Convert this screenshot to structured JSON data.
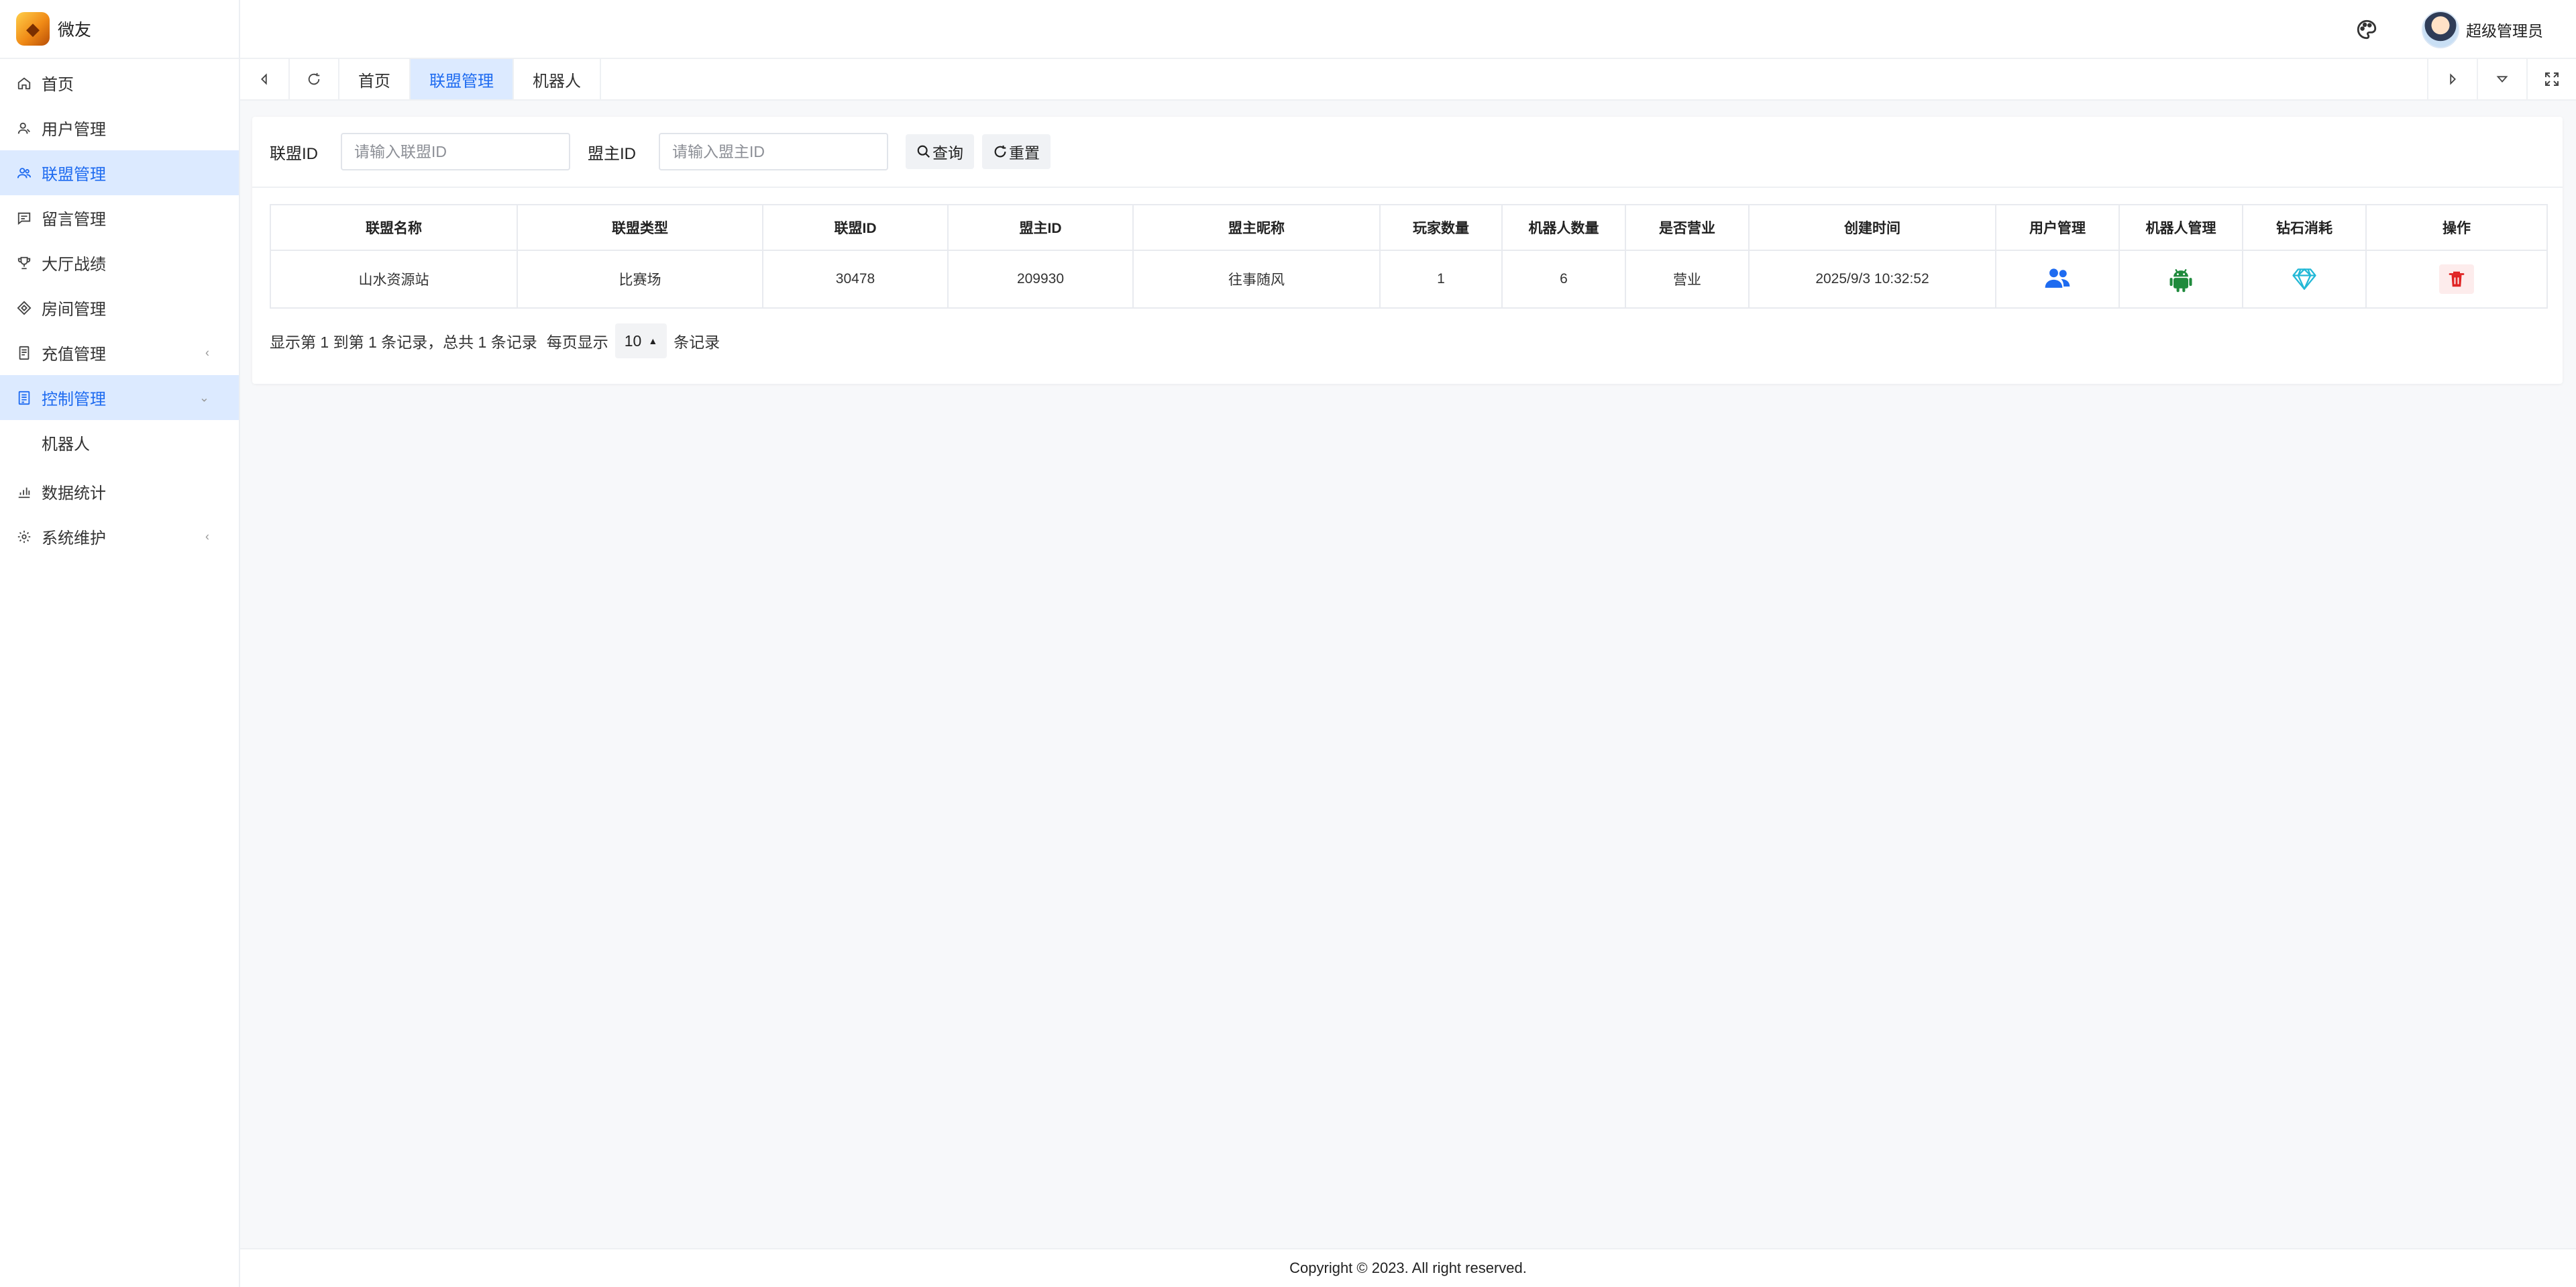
{
  "app": {
    "name": "微友"
  },
  "header": {
    "user_name": "超级管理员"
  },
  "sidebar": {
    "items": [
      {
        "label": "首页",
        "icon": "home-icon"
      },
      {
        "label": "用户管理",
        "icon": "user-icon"
      },
      {
        "label": "联盟管理",
        "icon": "users-icon",
        "active": true
      },
      {
        "label": "留言管理",
        "icon": "message-icon"
      },
      {
        "label": "大厅战绩",
        "icon": "trophy-icon"
      },
      {
        "label": "房间管理",
        "icon": "diamond-icon"
      },
      {
        "label": "充值管理",
        "icon": "receipt-icon"
      },
      {
        "label": "控制管理",
        "icon": "control-icon"
      },
      {
        "label": "机器人",
        "icon": ""
      },
      {
        "label": "数据统计",
        "icon": "chart-icon"
      },
      {
        "label": "系统维护",
        "icon": "gear-icon"
      }
    ]
  },
  "tabs": {
    "items": [
      "首页",
      "联盟管理",
      "机器人"
    ],
    "active": "联盟管理"
  },
  "search": {
    "alliance_id_label": "联盟ID",
    "alliance_id_placeholder": "请输入联盟ID",
    "owner_id_label": "盟主ID",
    "owner_id_placeholder": "请输入盟主ID",
    "query_label": "查询",
    "reset_label": "重置"
  },
  "table": {
    "headers": [
      "联盟名称",
      "联盟类型",
      "联盟ID",
      "盟主ID",
      "盟主昵称",
      "玩家数量",
      "机器人数量",
      "是否营业",
      "创建时间",
      "用户管理",
      "机器人管理",
      "钻石消耗",
      "操作"
    ],
    "rows": [
      {
        "name": "山水资源站",
        "type": "比赛场",
        "alliance_id": "30478",
        "owner_id": "209930",
        "owner_nick": "往事随风",
        "players": "1",
        "robots": "6",
        "open": "营业",
        "created": "2025/9/3 10:32:52"
      }
    ]
  },
  "pagination": {
    "summary": "显示第 1 到第 1 条记录，总共 1 条记录",
    "per_page_label": "每页显示",
    "per_page_value": "10",
    "unit_label": "条记录"
  },
  "footer": {
    "copyright": "Copyright © 2023. All right reserved."
  },
  "colors": {
    "accent": "#1e6bf0",
    "active_bg": "#dceaff",
    "robot_green": "#1f8a3c",
    "diamond_cyan": "#22b8d6",
    "danger": "#e02424"
  }
}
